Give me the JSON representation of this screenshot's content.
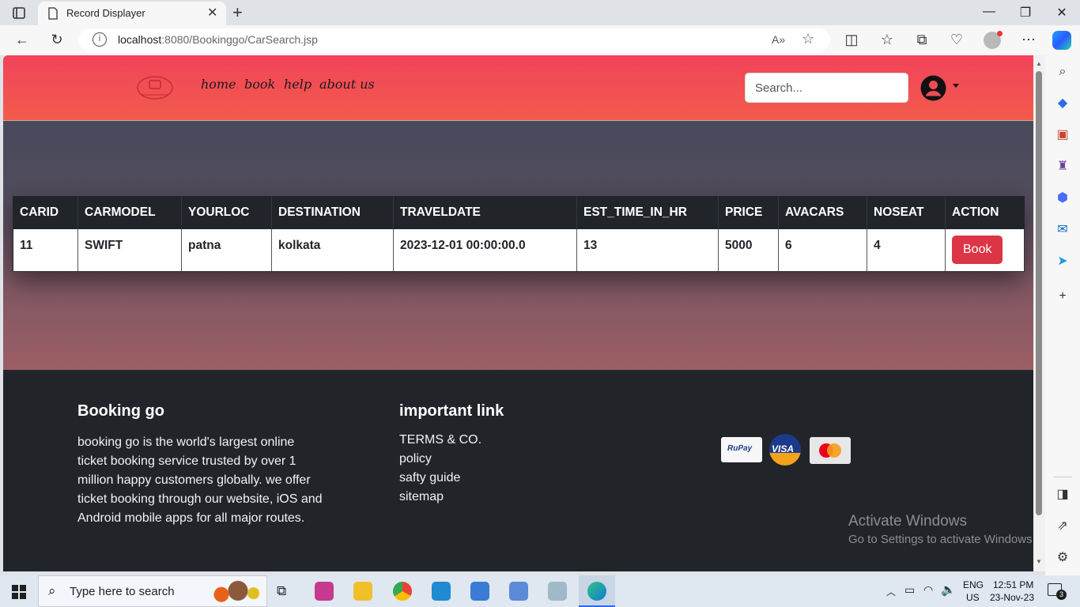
{
  "browser": {
    "tab_title": "Record Displayer",
    "url_host": "localhost",
    "url_rest": ":8080/Bookinggo/CarSearch.jsp",
    "read_aloud": "A»"
  },
  "navbar": {
    "links": [
      "home",
      "book",
      "help",
      "about us"
    ],
    "search_placeholder": "Search..."
  },
  "table": {
    "headers": [
      "CARID",
      "CARMODEL",
      "YOURLOC",
      "DESTINATION",
      "TRAVELDATE",
      "EST_TIME_IN_HR",
      "PRICE",
      "AVACARS",
      "NOSEAT",
      "ACTION"
    ],
    "rows": [
      {
        "carid": "11",
        "carmodel": "SWIFT",
        "yourloc": "patna",
        "destination": "kolkata",
        "traveldate": "2023-12-01 00:00:00.0",
        "est_time": "13",
        "price": "5000",
        "avacars": "6",
        "noseat": "4",
        "action_label": "Book"
      }
    ]
  },
  "footer": {
    "brand_title": "Booking go",
    "about": "booking go is the world's largest online ticket booking service trusted by over 1 million happy customers globally. we offer ticket booking through our website, iOS and Android mobile apps for all major routes.",
    "links_title": "important link",
    "links": [
      "TERMS & CO.",
      "policy",
      "safty guide",
      "sitemap"
    ],
    "payment_cards": [
      "RuPay",
      "VISA",
      "mastercard"
    ]
  },
  "watermark": {
    "line1": "Activate Windows",
    "line2": "Go to Settings to activate Windows."
  },
  "taskbar": {
    "search_placeholder": "Type here to search",
    "lang_top": "ENG",
    "lang_bottom": "US",
    "time": "12:51 PM",
    "date": "23-Nov-23",
    "notifications": "3"
  },
  "colors": {
    "navbar_top": "#f2435a",
    "accent_button": "#dc3545",
    "footer_bg": "#212529"
  }
}
